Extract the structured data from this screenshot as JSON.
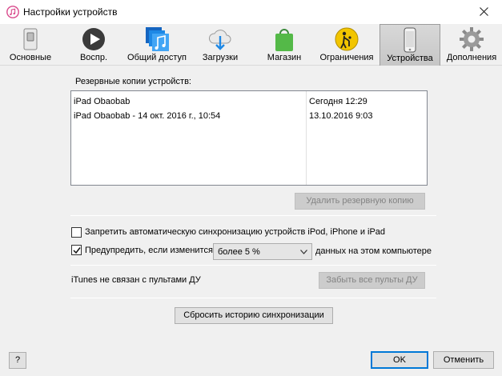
{
  "window": {
    "title": "Настройки устройств"
  },
  "toolbar": {
    "items": [
      {
        "label": "Основные",
        "icon": "switch-icon"
      },
      {
        "label": "Воспр.",
        "icon": "play-icon"
      },
      {
        "label": "Общий доступ",
        "icon": "music-note-icon"
      },
      {
        "label": "Загрузки",
        "icon": "cloud-download-icon"
      },
      {
        "label": "Магазин",
        "icon": "shopping-bag-icon"
      },
      {
        "label": "Ограничения",
        "icon": "parental-control-icon"
      },
      {
        "label": "Устройства",
        "icon": "phone-icon"
      },
      {
        "label": "Дополнения",
        "icon": "gear-icon"
      }
    ],
    "active": "Устройства"
  },
  "backups": {
    "label": "Резервные копии устройств:",
    "rows": [
      {
        "name": "iPad Obaobab",
        "date": "Сегодня 12:29"
      },
      {
        "name": "iPad Obaobab - 14 окт. 2016 г., 10:54",
        "date": "13.10.2016 9:03"
      }
    ],
    "delete_label": "Удалить резервную копию"
  },
  "sync": {
    "prevent_label": "Запретить автоматическую синхронизацию устройств iPod, iPhone и iPad",
    "prevent_checked": false,
    "warn_label": "Предупредить, если изменится",
    "warn_checked": true,
    "threshold_value": "более 5 %",
    "warn_suffix": "данных на этом компьютере"
  },
  "remotes": {
    "status": "iTunes не связан с пультами ДУ",
    "forget_label": "Забыть все пульты ДУ"
  },
  "reset_label": "Сбросить историю синхронизации",
  "footer": {
    "help_label": "?",
    "ok_label": "OK",
    "cancel_label": "Отменить"
  },
  "colors": {
    "accent": "#0078d7",
    "active_tab": "#c8c8c8",
    "background": "#f0f0f0"
  }
}
